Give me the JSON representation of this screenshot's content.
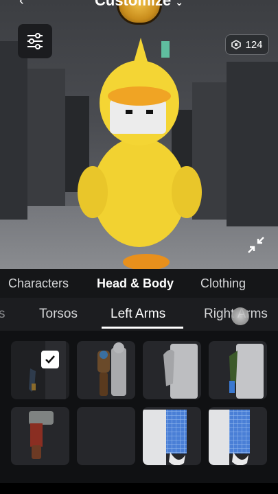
{
  "header": {
    "title": "Customize"
  },
  "robux": {
    "amount": "124"
  },
  "category_tabs": [
    {
      "label": "Characters",
      "active": false
    },
    {
      "label": "Head & Body",
      "active": true
    },
    {
      "label": "Clothing",
      "active": false
    }
  ],
  "sub_tabs": [
    {
      "label": "s",
      "active": false
    },
    {
      "label": "Torsos",
      "active": false
    },
    {
      "label": "Left Arms",
      "active": true
    },
    {
      "label": "Right Arms",
      "active": false
    }
  ],
  "items": [
    {
      "name": "left-arm-item-1",
      "selected": true
    },
    {
      "name": "left-arm-item-2",
      "selected": false
    },
    {
      "name": "left-arm-item-3",
      "selected": false
    },
    {
      "name": "left-arm-item-4",
      "selected": false
    },
    {
      "name": "left-arm-item-5",
      "selected": false
    },
    {
      "name": "left-arm-item-6",
      "selected": false
    },
    {
      "name": "left-arm-item-7",
      "selected": false
    },
    {
      "name": "left-arm-item-8",
      "selected": false
    }
  ],
  "icons": {
    "filter": "sliders-icon",
    "currency": "robux-icon",
    "expand": "collapse-arrows-icon",
    "check": "checkmark-icon"
  },
  "colors": {
    "background": "#111214",
    "accent": "#ffffff",
    "tile": "#26272b"
  }
}
